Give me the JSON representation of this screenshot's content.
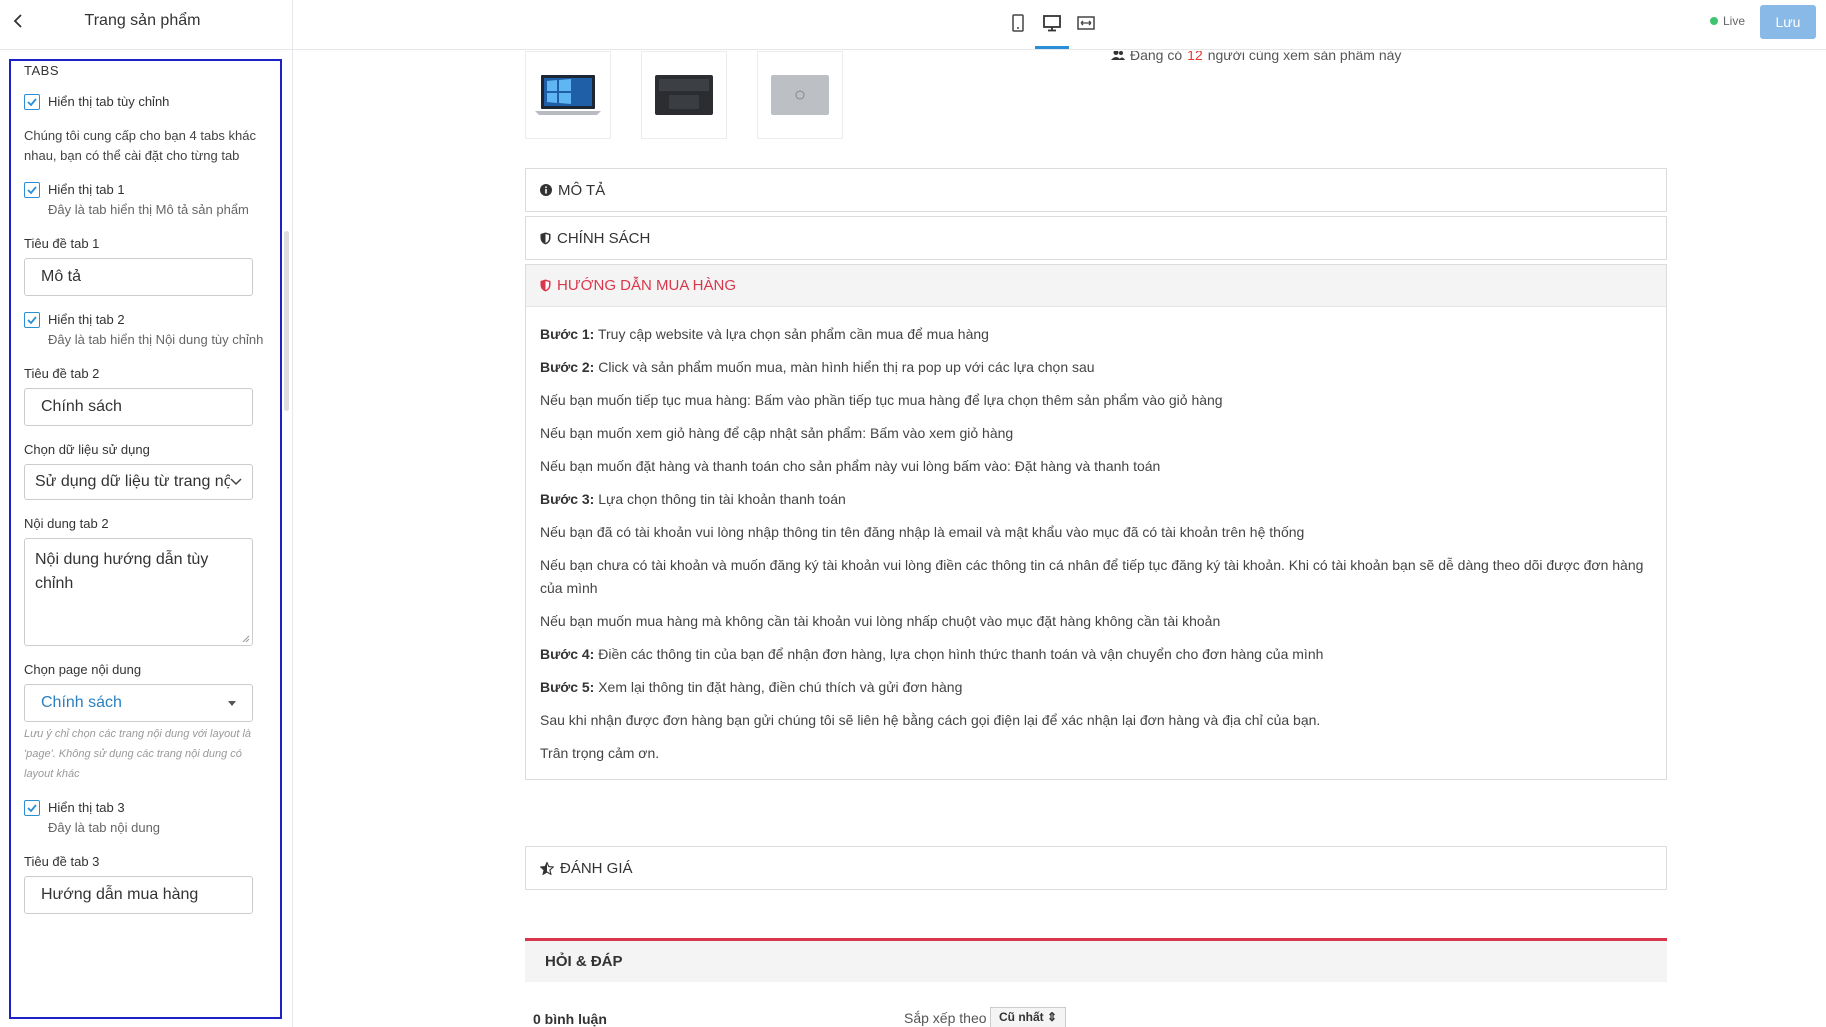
{
  "topbar": {
    "sidebar_title": "Trang sản phẩm",
    "live_label": "Live",
    "save_label": "Lưu",
    "accent_color": "#2a8fd6",
    "live_color": "#3ec46d"
  },
  "sidebar": {
    "section_title": "TABS",
    "show_custom_tab": "Hiển thị tab tùy chỉnh",
    "intro": "Chúng tôi cung cấp cho bạn 4 tabs khác nhau, bạn có thể cài đặt cho từng tab",
    "tab1": {
      "check_label": "Hiển thị tab 1",
      "desc": "Đây là tab hiển thị Mô tả sản phẩm",
      "title_label": "Tiêu đề tab 1",
      "title_value": "Mô tả"
    },
    "tab2": {
      "check_label": "Hiển thị tab 2",
      "desc": "Đây là tab hiển thị Nội dung tùy chỉnh",
      "title_label": "Tiêu đề tab 2",
      "title_value": "Chính sách",
      "data_label": "Chọn dữ liệu sử dụng",
      "data_value": "Sử dụng dữ liệu từ trang nội dung",
      "content_label": "Nội dung tab 2",
      "content_value": "Nội dung hướng dẫn tùy chỉnh",
      "page_label": "Chọn page nội dung",
      "page_value": "Chính sách",
      "note": "Lưu ý chỉ chọn các trang nội dung với layout là 'page'. Không sử dụng các trang nội dung có layout khác"
    },
    "tab3": {
      "check_label": "Hiển thị tab 3",
      "desc": "Đây là tab nội dung",
      "title_label": "Tiêu đề tab 3",
      "title_value": "Hướng dẫn mua hàng"
    }
  },
  "preview": {
    "viewers_prefix": "Đang có",
    "viewers_count": "12",
    "viewers_suffix": "người cùng xem sản phẩm này",
    "tabs": {
      "description": "MÔ TẢ",
      "policy": "CHÍNH SÁCH",
      "guide": "HƯỚNG DẪN MUA HÀNG",
      "review": "ĐÁNH GIÁ"
    },
    "guide": {
      "s1_label": "Bước 1:",
      "s1_text": "Truy cập website và lựa chọn sản phẩm cần mua để mua hàng",
      "s2_label": "Bước 2:",
      "s2_text": "Click và sản phẩm muốn mua, màn hình hiển thị ra pop up với các lựa chọn sau",
      "p1": "Nếu bạn muốn tiếp tục mua hàng: Bấm vào phần tiếp tục mua hàng để lựa chọn thêm sản phẩm vào giỏ hàng",
      "p2": "Nếu bạn muốn xem giỏ hàng để cập nhật sản phẩm: Bấm vào xem giỏ hàng",
      "p3": "Nếu bạn muốn đặt hàng và thanh toán cho sản phẩm này vui lòng bấm vào: Đặt hàng và thanh toán",
      "s3_label": "Bước 3:",
      "s3_text": "Lựa chọn thông tin tài khoản thanh toán",
      "p4": "Nếu bạn đã có tài khoản vui lòng nhập thông tin tên đăng nhập là email và mật khẩu vào mục đã có tài khoản trên hệ thống",
      "p5": "Nếu bạn chưa có tài khoản và muốn đăng ký tài khoản vui lòng điền các thông tin cá nhân để tiếp tục đăng ký tài khoản. Khi có tài khoản bạn sẽ dễ dàng theo dõi được đơn hàng của mình",
      "p6": "Nếu bạn muốn mua hàng mà không cần tài khoản vui lòng nhấp chuột vào mục đặt hàng không cần tài khoản",
      "s4_label": "Bước 4:",
      "s4_text": "Điền các thông tin của bạn để nhận đơn hàng, lựa chọn hình thức thanh toán và vận chuyển cho đơn hàng của mình",
      "s5_label": "Bước 5:",
      "s5_text": "Xem lại thông tin đặt hàng, điền chú thích và gửi đơn hàng",
      "p7": "Sau khi nhận được đơn hàng bạn gửi chúng tôi sẽ liên hệ bằng cách gọi điện lại để xác nhận lại đơn hàng và địa chỉ của bạn.",
      "p8": "Trân trọng cảm ơn."
    },
    "qa_title": "HỎI & ĐÁP",
    "comments_count": "0 bình luận",
    "sort_label": "Sắp xếp theo",
    "sort_value": "Cũ nhất",
    "active_tab_color": "#d9364b"
  }
}
